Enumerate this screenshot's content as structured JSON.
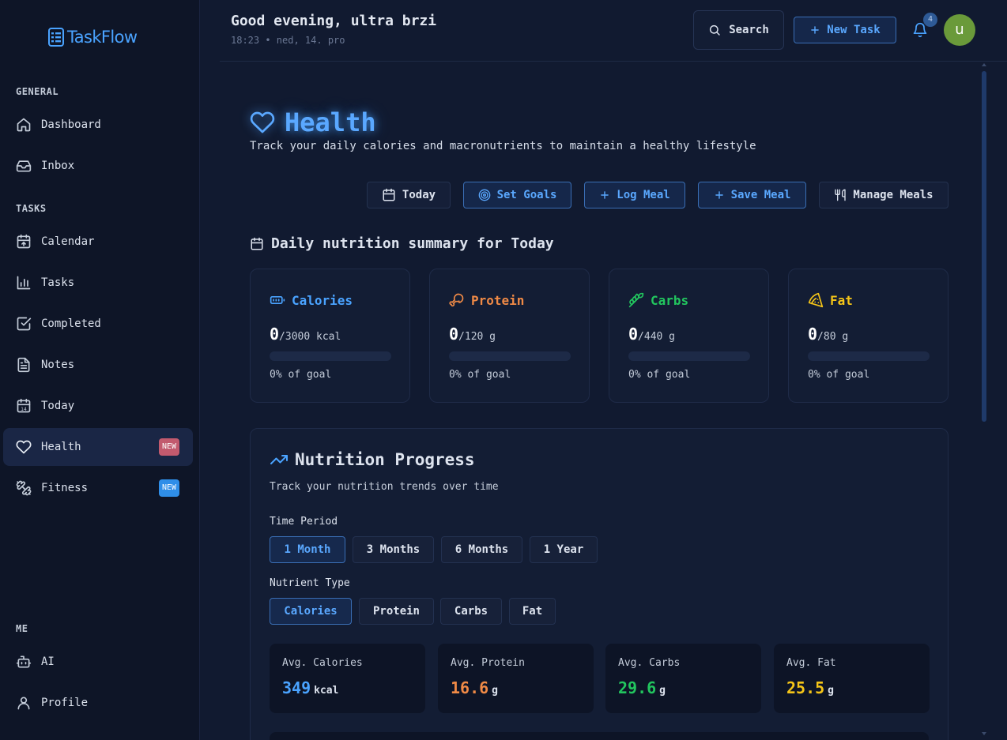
{
  "app": {
    "name": "TaskFlow"
  },
  "sidebar": {
    "sections": {
      "general": "GENERAL",
      "tasks": "TASKS",
      "me": "ME"
    },
    "items": [
      {
        "label": "Dashboard"
      },
      {
        "label": "Inbox"
      },
      {
        "label": "Calendar"
      },
      {
        "label": "Tasks"
      },
      {
        "label": "Completed"
      },
      {
        "label": "Notes"
      },
      {
        "label": "Today"
      },
      {
        "label": "Health",
        "badge": "NEW",
        "badge_color": "#c25a6e",
        "active": true
      },
      {
        "label": "Fitness",
        "badge": "NEW",
        "badge_color": "#2f8ee8"
      },
      {
        "label": "AI"
      },
      {
        "label": "Profile"
      }
    ]
  },
  "header": {
    "greeting": "Good evening, ultra brzi",
    "datetime": "18:23 • ned, 14. pro",
    "search_label": "Search",
    "new_task_label": "New Task",
    "notification_count": "4",
    "avatar_initial": "u"
  },
  "page": {
    "title": "Health",
    "subtitle": "Track your daily calories and macronutrients to maintain a healthy lifestyle",
    "actions": {
      "today": "Today",
      "set_goals": "Set Goals",
      "log_meal": "Log Meal",
      "save_meal": "Save Meal",
      "manage_meals": "Manage Meals"
    }
  },
  "summary": {
    "title": "Daily nutrition summary for Today",
    "cards": [
      {
        "name": "Calories",
        "value": "0",
        "goal": "/3000 kcal",
        "percent": 0,
        "percent_label": "0% of goal",
        "color": "#4aa3ff",
        "icon": "battery-icon"
      },
      {
        "name": "Protein",
        "value": "0",
        "goal": "/120 g",
        "percent": 0,
        "percent_label": "0% of goal",
        "color": "#f08a46",
        "icon": "drumstick-icon"
      },
      {
        "name": "Carbs",
        "value": "0",
        "goal": "/440 g",
        "percent": 0,
        "percent_label": "0% of goal",
        "color": "#22c55e",
        "icon": "wheat-icon"
      },
      {
        "name": "Fat",
        "value": "0",
        "goal": "/80 g",
        "percent": 0,
        "percent_label": "0% of goal",
        "color": "#f5c518",
        "icon": "pizza-icon"
      }
    ]
  },
  "progress": {
    "title": "Nutrition Progress",
    "subtitle": "Track your nutrition trends over time",
    "time_period_label": "Time Period",
    "time_periods": [
      "1 Month",
      "3 Months",
      "6 Months",
      "1 Year"
    ],
    "selected_time_period": "1 Month",
    "nutrient_type_label": "Nutrient Type",
    "nutrient_types": [
      "Calories",
      "Protein",
      "Carbs",
      "Fat"
    ],
    "selected_nutrient_type": "Calories",
    "averages": [
      {
        "label": "Avg. Calories",
        "value": "349",
        "unit": "kcal",
        "color": "#4aa3ff"
      },
      {
        "label": "Avg. Protein",
        "value": "16.6",
        "unit": "g",
        "color": "#f08a46"
      },
      {
        "label": "Avg. Carbs",
        "value": "29.6",
        "unit": "g",
        "color": "#22c55e"
      },
      {
        "label": "Avg. Fat",
        "value": "25.5",
        "unit": "g",
        "color": "#f5c518"
      }
    ]
  }
}
